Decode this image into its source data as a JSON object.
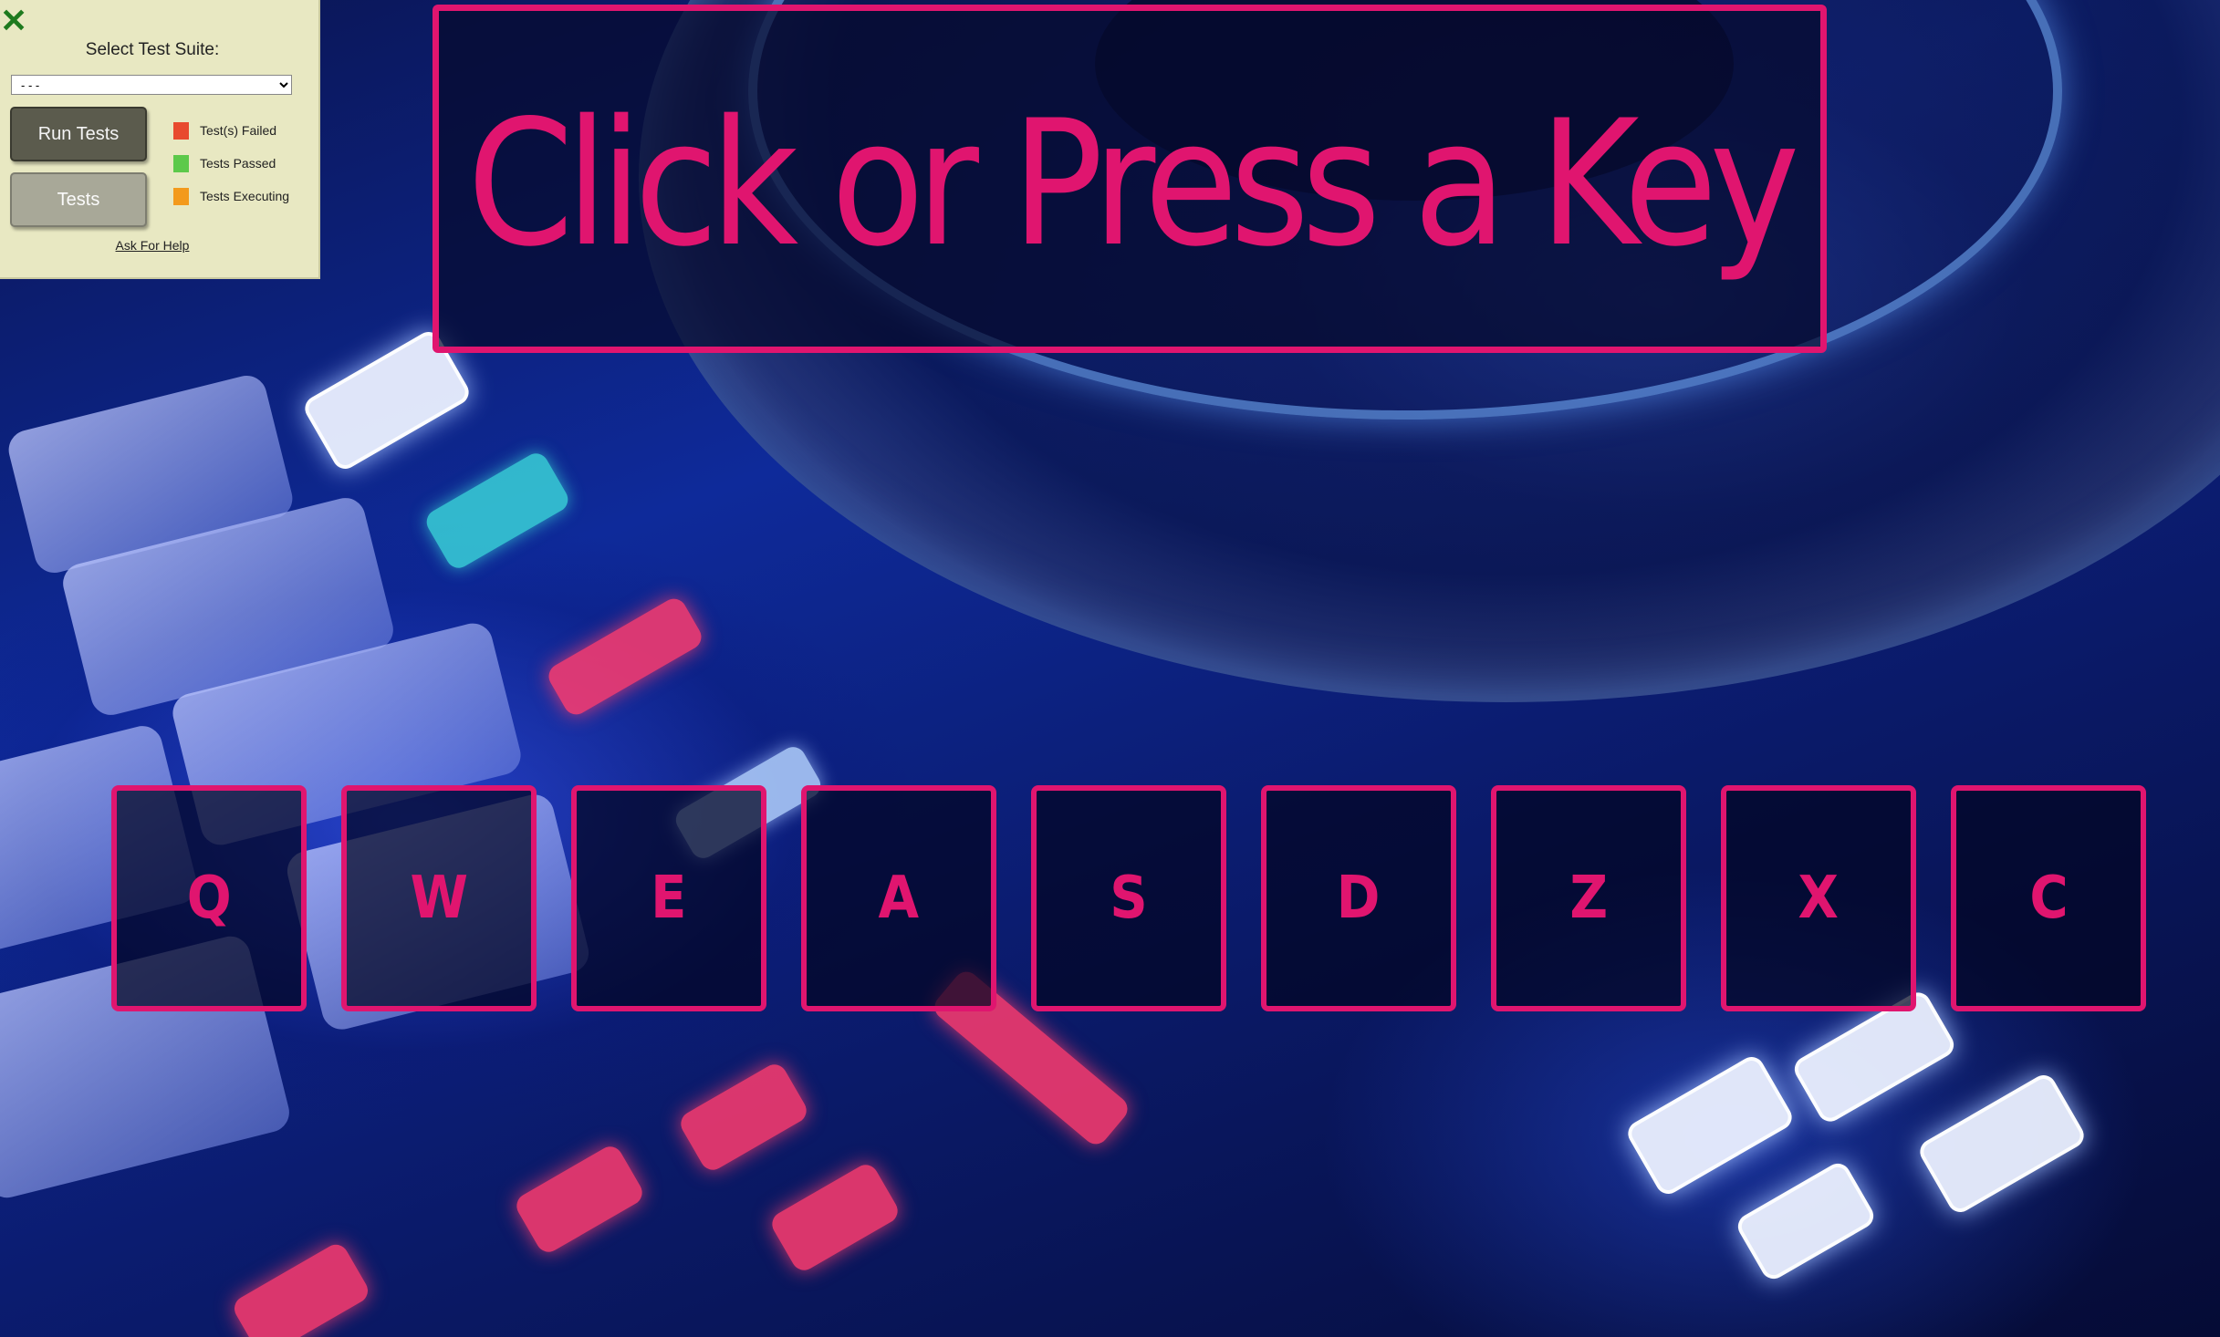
{
  "test_panel": {
    "close_glyph": "✕",
    "suite_label": "Select Test Suite:",
    "suite_selected": "- - -",
    "run_tests_label": "Run Tests",
    "tests_label": "Tests",
    "legend": [
      {
        "label": "Test(s) Failed",
        "color": "#e84a2e"
      },
      {
        "label": "Tests Passed",
        "color": "#5cc94a"
      },
      {
        "label": "Tests Executing",
        "color": "#f39a1c"
      }
    ],
    "help_link": "Ask For Help"
  },
  "prompt": {
    "text": "Click or Press a Key"
  },
  "keys": [
    "Q",
    "W",
    "E",
    "A",
    "S",
    "D",
    "Z",
    "X",
    "C"
  ],
  "colors": {
    "accent": "#e0156f",
    "panel_background": "#e8e8c2"
  }
}
